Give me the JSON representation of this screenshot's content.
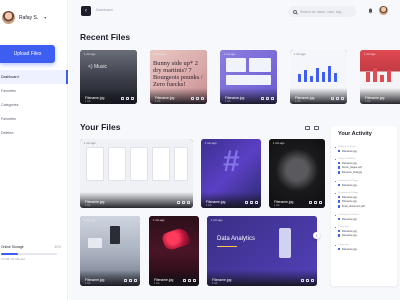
{
  "sidebar": {
    "profile_name": "Rafay S.",
    "upload_label": "Upload Files",
    "nav": [
      {
        "label": "Dashboard",
        "active": true
      },
      {
        "label": "Favorites",
        "active": false
      },
      {
        "label": "Categories",
        "active": false
      },
      {
        "label": "Favorites",
        "active": false
      },
      {
        "label": "Deleted",
        "active": false
      }
    ],
    "storage": {
      "label": "Online Storage",
      "percent_label": "30%",
      "used_fraction": 0.3,
      "detail": "6.5 GB / 20 GB used"
    }
  },
  "topbar": {
    "back_label": "‹",
    "breadcrumb": "Dashboard",
    "search_placeholder": "Search for name, color, tag..."
  },
  "recent": {
    "title": "Recent Files",
    "items": [
      {
        "badge": "1 min ago",
        "name": "Filename.jpg",
        "size": "1 mb",
        "thumb_text": "<) Music"
      },
      {
        "badge": "1 min ago",
        "name": "Filename.jpg",
        "size": "1 mb",
        "thumb_text": "Bunny side up* 2 dry martinis? 7 Bourgeois pounks / Zero fuecks!"
      },
      {
        "badge": "1 min ago",
        "name": "Filename.jpg",
        "size": "1 mb",
        "thumb_text": ""
      },
      {
        "badge": "1 min ago",
        "name": "Filename.jpg",
        "size": "1 mb",
        "thumb_text": ""
      },
      {
        "badge": "1 min ago",
        "name": "Filename.jpg",
        "size": "1 mb",
        "thumb_text": ""
      }
    ]
  },
  "yours": {
    "title": "Your Files",
    "items": [
      {
        "badge": "1 min ago",
        "name": "Filename.jpg",
        "size": "1 mb"
      },
      {
        "badge": "1 min ago",
        "name": "Filename.jpg",
        "size": "1 mb"
      },
      {
        "badge": "1 min ago",
        "name": "Filename.jpg",
        "size": "1 mb"
      },
      {
        "badge": "1 min ago",
        "name": "Filename.jpg",
        "size": "1 mb"
      },
      {
        "badge": "1 min ago",
        "name": "Filename.jpg",
        "size": "1 mb"
      },
      {
        "badge": "1 min ago",
        "name": "Filename.jpg",
        "size": "1 mb",
        "thumb_text": "Data Analytics"
      }
    ]
  },
  "activity": {
    "title": "Your Activity",
    "groups": [
      {
        "time": "Today at 10:14am",
        "files": [
          "Filename.jpg"
        ]
      },
      {
        "time": "Today at 09:58am",
        "files": [
          "Filename.jpg",
          "Some_pages.pdf",
          "filename_final.jpg"
        ]
      },
      {
        "time": "Yesterday at 6:20pm",
        "files": [
          "Filename.jpg"
        ]
      },
      {
        "time": "Yesterday at 4:05pm",
        "files": [
          "Filename.jpg",
          "Filename.jpg",
          "Final_document.pdf"
        ]
      },
      {
        "time": "Yesterday at 11:31am",
        "files": [
          "Filename.jpg"
        ]
      },
      {
        "time": "2 days ago",
        "files": [
          "Filename.jpg",
          "Filename.jpg"
        ]
      },
      {
        "time": "2 days ago",
        "files": [
          "Filename.jpg"
        ]
      }
    ]
  },
  "colors": {
    "accent": "#3d5ef0",
    "sidebar_bg": "#ffffff",
    "main_bg": "#f7f8fb"
  }
}
